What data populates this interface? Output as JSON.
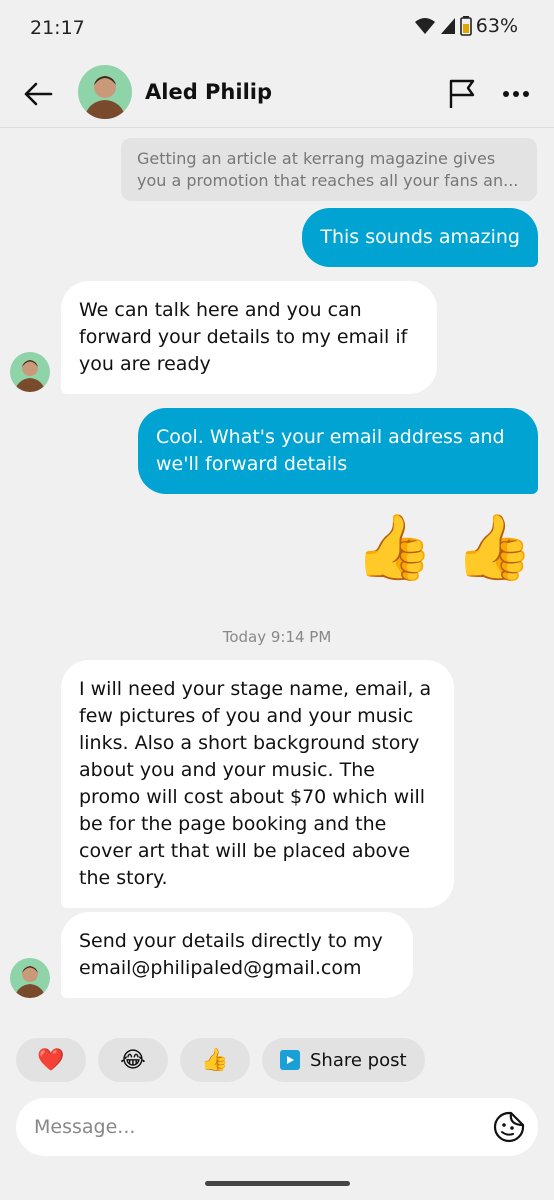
{
  "status": {
    "time": "21:17",
    "battery": "63%"
  },
  "header": {
    "name": "Aled Philip",
    "back_icon": "arrow-left-icon",
    "flag_icon": "flag-icon",
    "more_icon": "more-horizontal-icon"
  },
  "messages": {
    "quoted_line1": "Getting an article at kerrang magazine gives",
    "quoted_line2": "you  a promotion that reaches all your fans an...",
    "m1": "This sounds amazing",
    "m2": "We can talk here and you can forward your details to my email if you are ready",
    "m3": "Cool. What's your email address and we'll forward details",
    "m4": "👍 👍",
    "timestamp": "Today 9:14 PM",
    "m5": "I will need your stage name, email, a few pictures  of you and your music links. Also a short background story about you and your music. The promo will cost about $70 which will be for the page booking and the cover art that will be placed above the story.",
    "m6": "Send your details directly to my email@philipaled@gmail.com"
  },
  "quick_replies": {
    "heart": "❤️",
    "laugh": "😂",
    "thumbs": "👍",
    "share_label": "Share post"
  },
  "composer": {
    "placeholder": "Message..."
  },
  "colors": {
    "outgoing": "#00a3d2",
    "incoming": "#ffffff",
    "background": "#f0f0f0"
  }
}
